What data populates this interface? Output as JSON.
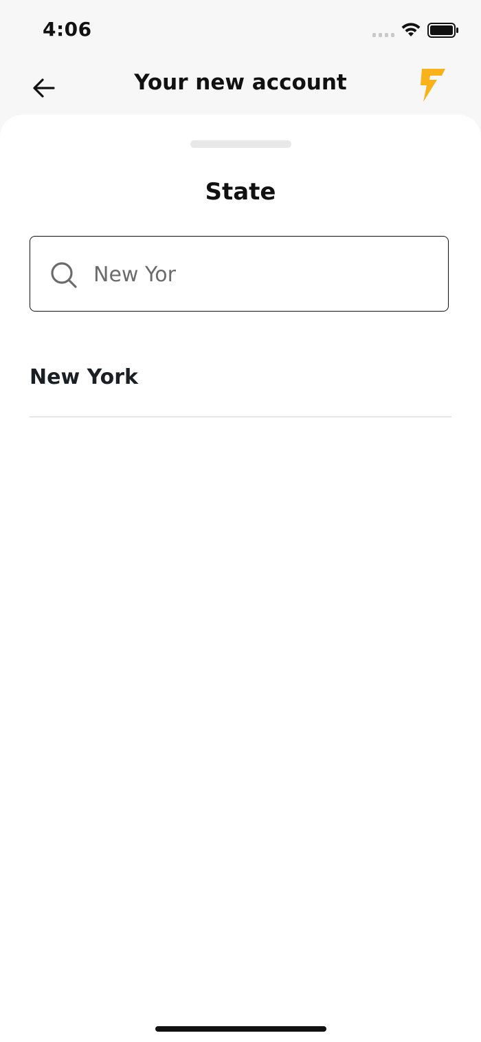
{
  "status_bar": {
    "time": "4:06",
    "signal_icon": "signal-dots-icon",
    "wifi_icon": "wifi-icon",
    "battery_icon": "battery-full-icon"
  },
  "header": {
    "back_icon": "arrow-left-icon",
    "title": "Your new account",
    "logo_icon": "lightning-logo-icon",
    "logo_color": "#F9B21A"
  },
  "sheet": {
    "title": "State",
    "search": {
      "icon": "search-icon",
      "value": "New Yor"
    },
    "results": [
      {
        "label": "New York"
      }
    ]
  }
}
